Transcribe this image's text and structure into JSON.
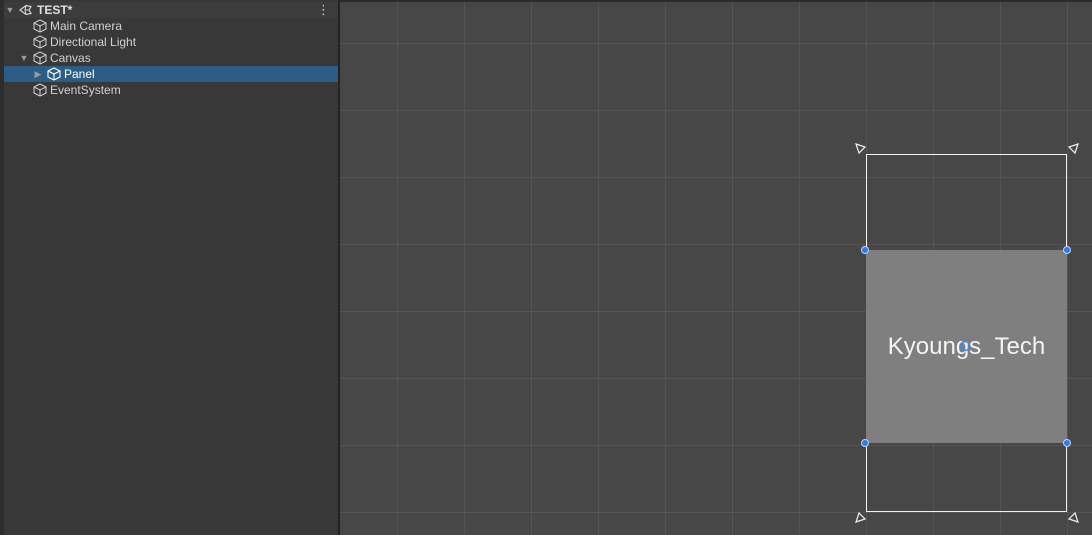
{
  "hierarchy": {
    "scene_name": "TEST*",
    "items": [
      {
        "label": "Main Camera",
        "icon": "gameobject-cube-icon"
      },
      {
        "label": "Directional Light",
        "icon": "gameobject-cube-icon"
      },
      {
        "label": "Canvas",
        "icon": "gameobject-cube-icon",
        "expanded": true
      },
      {
        "label": "Panel",
        "icon": "gameobject-cube-icon",
        "selected": true,
        "collapsed_children": true
      },
      {
        "label": "EventSystem",
        "icon": "gameobject-cube-icon"
      }
    ],
    "menu_icon": "kebab-menu-icon"
  },
  "scene_view": {
    "panel_text": "Kyoungs_Tech",
    "colors": {
      "selection": "#2c5d87",
      "panel_fill": "#7f7f7f",
      "handle": "#2f7de0",
      "scene_background": "#474747"
    }
  }
}
